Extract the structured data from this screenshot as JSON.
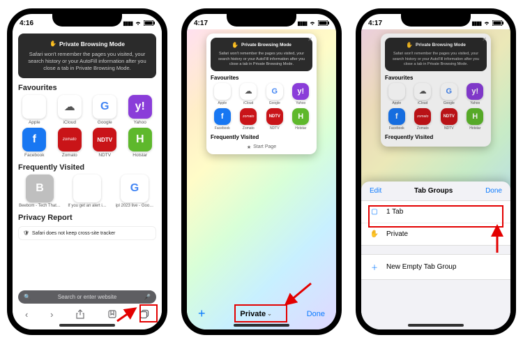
{
  "phone1": {
    "status_time": "4:16",
    "banner": {
      "title": "Private Browsing Mode",
      "body": "Safari won't remember the pages you visited, your search history or your AutoFill information after you close a tab in Private Browsing Mode."
    },
    "fav_heading": "Favourites",
    "favs": [
      {
        "label": "Apple",
        "icon": ""
      },
      {
        "label": "iCloud",
        "icon": "☁"
      },
      {
        "label": "Google",
        "icon": "G"
      },
      {
        "label": "Yahoo",
        "icon": "y!"
      },
      {
        "label": "Facebook",
        "icon": "f"
      },
      {
        "label": "Zomato",
        "icon": "zomato"
      },
      {
        "label": "NDTV",
        "icon": "NDTV"
      },
      {
        "label": "Hotstar",
        "icon": "H"
      }
    ],
    "fv_heading": "Frequently Visited",
    "fv": [
      {
        "label": "Beebom - Tech That…",
        "icon": "B"
      },
      {
        "label": "If you get an alert i…",
        "icon": ""
      },
      {
        "label": "ipl 2023 live - Goo…",
        "icon": "G"
      }
    ],
    "privacy_heading": "Privacy Report",
    "privacy_row": "Safari does not keep cross-site tracker",
    "search_placeholder": "Search or enter website"
  },
  "phone2": {
    "status_time": "4:17",
    "start_page": "Start Page",
    "toolbar": {
      "new": "+",
      "private": "Private",
      "done": "Done"
    }
  },
  "phone3": {
    "status_time": "4:17",
    "sheet": {
      "edit": "Edit",
      "title": "Tab Groups",
      "done": "Done",
      "rows": [
        {
          "icon": "▢",
          "label": "1 Tab"
        },
        {
          "icon": "✋",
          "label": "Private"
        },
        {
          "icon": "＋",
          "label": "New Empty Tab Group"
        }
      ]
    }
  }
}
